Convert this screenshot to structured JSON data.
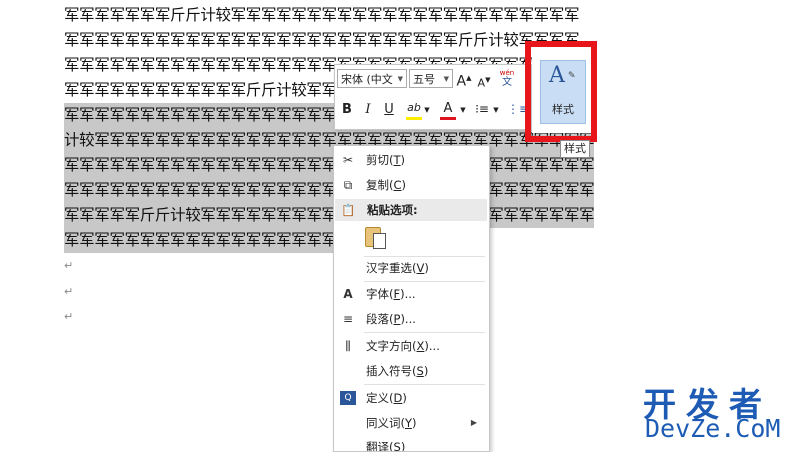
{
  "document": {
    "lines": [
      {
        "text": "军军军军军军军斤斤计较军军军军军军军军军军军军军军军军军军军军军军军",
        "selected": false
      },
      {
        "text": "军军军军军军军军军军军军军军军军军军军军军军军军军军斤斤计较军军军军",
        "selected": false
      },
      {
        "text": "军军军军军军军军军军军军军军军军军军军军军军军军军军军军军军军军军军军",
        "selected": false
      },
      {
        "text": "军军军军军军军军军军军军斤斤计较军军军军军军军军军军军军军军军军军军军",
        "selected": false
      },
      {
        "text": "军军军军军军军军军军军军军军军军军军军军军军军军军军军军军军军军军斤斤",
        "selected": true
      },
      {
        "text": "计较军军军军军军军军军军军军军军军军军军军军军军军军军军军军军军军军军",
        "selected": true
      },
      {
        "text": "军军军军军军军军军军军军军军军军军军军军军军军军军军军军军军军军军军军",
        "selected": true
      },
      {
        "text": "军军军军军军军军军军军军军军军军军军军军军军军军军军军军军军军军军军军",
        "selected": true
      },
      {
        "text": "军军军军军斤斤计较军军军军军军军军军军军军军军军军军军军军军军军军军军",
        "selected": true
      },
      {
        "text": "军军军军军军军军军军军军军军军军军军军军军军军军军",
        "selected": true,
        "end_mark": "↵"
      }
    ],
    "paragraph_marks": [
      "↵",
      "↵",
      "↵"
    ]
  },
  "mini_toolbar": {
    "font_name": "宋体 (中文",
    "font_size": "五号",
    "grow_font": "A",
    "shrink_font": "A",
    "phonetic_top": "wén",
    "phonetic_bottom": "文",
    "bold": "B",
    "italic": "I",
    "underline": "U",
    "highlight": "ab",
    "font_color": "A",
    "highlight_color": "#ffee00",
    "font_color_value": "#e0141e",
    "styles_label": "样式",
    "styles_glyph": "A"
  },
  "tooltip": "样式",
  "context_menu": {
    "items": [
      {
        "icon": "scissors-icon",
        "glyph": "✂",
        "label": "剪切(",
        "key": "T",
        "end": ")"
      },
      {
        "icon": "copy-icon",
        "glyph": "⧉",
        "label": "复制(",
        "key": "C",
        "end": ")"
      },
      {
        "icon": "paste-icon",
        "glyph": "📋",
        "label": "粘贴选项:",
        "key": "",
        "end": ""
      },
      {
        "icon": "reconvert-icon",
        "glyph": "",
        "label": "汉字重选(",
        "key": "V",
        "end": ")"
      },
      {
        "icon": "font-icon",
        "glyph": "A",
        "label": "字体(",
        "key": "F",
        "end": ")..."
      },
      {
        "icon": "paragraph-icon",
        "glyph": "≡",
        "label": "段落(",
        "key": "P",
        "end": ")..."
      },
      {
        "icon": "text-direction-icon",
        "glyph": "⫼",
        "label": "文字方向(",
        "key": "X",
        "end": ")..."
      },
      {
        "icon": "symbol-icon",
        "glyph": "",
        "label": "插入符号(",
        "key": "S",
        "end": ")"
      },
      {
        "icon": "define-icon",
        "glyph": "🔍",
        "label": "定义(",
        "key": "D",
        "end": ")"
      },
      {
        "icon": "synonym-icon",
        "glyph": "",
        "label": "同义词(",
        "key": "Y",
        "end": ")"
      },
      {
        "icon": "translate-icon",
        "glyph": "",
        "label": "翻译(",
        "key": "S",
        "end": ")"
      }
    ]
  },
  "watermark": {
    "chinese": "开发者",
    "english": "DevZe.CoM"
  }
}
